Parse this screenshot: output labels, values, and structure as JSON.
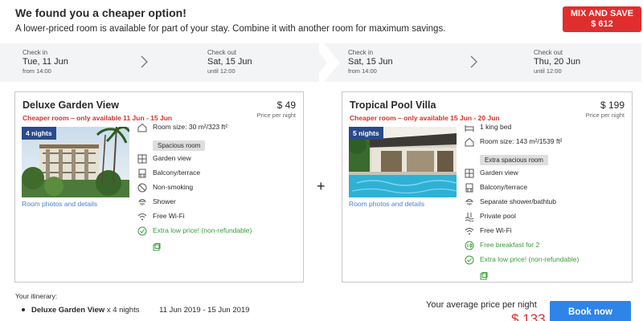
{
  "header": {
    "title": "We found you a cheaper option!",
    "subtitle": "A lower-priced room is available for part of your stay. Combine it with another room for maximum savings."
  },
  "mix_badge": {
    "title": "MIX AND SAVE",
    "amount": "$ 612",
    "color": "#e12d2d"
  },
  "dates": [
    {
      "checkin_label": "Check in",
      "checkin_date": "Tue, 11 Jun",
      "checkin_time": "from 14:00",
      "checkout_label": "Check out",
      "checkout_date": "Sat, 15 Jun",
      "checkout_time": "until 12:00"
    },
    {
      "checkin_label": "Check in",
      "checkin_date": "Sat, 15 Jun",
      "checkin_time": "from 14:00",
      "checkout_label": "Check out",
      "checkout_date": "Thu, 20 Jun",
      "checkout_time": "until 12:00"
    }
  ],
  "rooms": [
    {
      "name": "Deluxe Garden View",
      "cheaper_note": "Cheaper room – only available 11 Jun - 15 Jun",
      "price": "$ 49",
      "price_note": "Price per night",
      "nights": "4 nights",
      "photo_link": "Room photos and details",
      "amenities": [
        {
          "icon": "room-size-icon",
          "text": "Room size: 30 m²/323 ft²",
          "tag": "Spacious room"
        },
        {
          "icon": "garden-view-icon",
          "text": "Garden view"
        },
        {
          "icon": "balcony-icon",
          "text": "Balcony/terrace"
        },
        {
          "icon": "non-smoking-icon",
          "text": "Non-smoking"
        },
        {
          "icon": "shower-icon",
          "text": "Shower"
        },
        {
          "icon": "wifi-icon",
          "text": "Free Wi-Fi"
        },
        {
          "icon": "deal-icon",
          "text": "Extra low price! (non-refundable)",
          "green": true
        }
      ]
    },
    {
      "name": "Tropical Pool Villa",
      "cheaper_note": "Cheaper room – only available 15 Jun - 20 Jun",
      "price": "$ 199",
      "price_note": "Price per night",
      "nights": "5 nights",
      "photo_link": "Room photos and details",
      "amenities": [
        {
          "icon": "bed-icon",
          "text": "1 king bed"
        },
        {
          "icon": "room-size-icon",
          "text": "Room size: 143 m²/1539 ft²",
          "tag": "Extra spacious room"
        },
        {
          "icon": "garden-view-icon",
          "text": "Garden view"
        },
        {
          "icon": "balcony-icon",
          "text": "Balcony/terrace"
        },
        {
          "icon": "shower-icon",
          "text": "Separate shower/bathtub"
        },
        {
          "icon": "pool-icon",
          "text": "Private pool"
        },
        {
          "icon": "wifi-icon",
          "text": "Free Wi-Fi"
        },
        {
          "icon": "breakfast-icon",
          "text": "Free breakfast for 2",
          "green": true
        },
        {
          "icon": "deal-icon",
          "text": "Extra low price! (non-refundable)",
          "green": true
        }
      ]
    }
  ],
  "plus_sign": "+",
  "itinerary": {
    "label": "Your itinerary:",
    "rows": [
      {
        "room": "Deluxe Garden View",
        "nights": "x 4 nights",
        "dates": "11 Jun 2019 - 15 Jun 2019"
      }
    ]
  },
  "summary": {
    "avg_label": "Your average price per night",
    "avg_price": "$ 133",
    "book_label": "Book now"
  }
}
